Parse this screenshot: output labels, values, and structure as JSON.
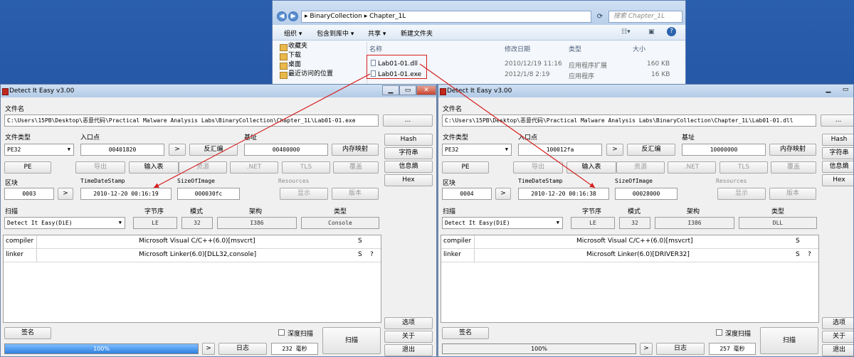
{
  "explorer": {
    "path": [
      "BinaryCollection",
      "Chapter_1L"
    ],
    "search_placeholder": "搜索 Chapter_1L",
    "toolbar": [
      "组织 ▾",
      "包含到库中 ▾",
      "共享 ▾",
      "新建文件夹"
    ],
    "sidebar": [
      "收藏夹",
      "下载",
      "桌面",
      "最近访问的位置"
    ],
    "columns": [
      "名称",
      "修改日期",
      "类型",
      "大小"
    ],
    "files": [
      {
        "name": "Lab01-01.dll",
        "date": "2010/12/19 11:16",
        "type": "应用程序扩展",
        "size": "160 KB"
      },
      {
        "name": "Lab01-01.exe",
        "date": "2012/1/8 2:19",
        "type": "应用程序",
        "size": "16 KB"
      }
    ]
  },
  "left": {
    "title": "Detect It Easy v3.00",
    "filename_label": "文件名",
    "filename": "C:\\Users\\15PB\\Desktop\\恶意代码\\Practical Malware Analysis Labs\\BinaryCollection\\Chapter_1L\\Lab01-01.exe",
    "filetype_label": "文件类型",
    "filetype": "PE32",
    "entry_label": "入口点",
    "entry": "00401820",
    "disasm": "反汇编",
    "base_label": "基址",
    "base": "00400000",
    "memmap": "内存映射",
    "pe": "PE",
    "export": "导出",
    "import": "输入表",
    "resource": "资源",
    "net": ".NET",
    "tls": "TLS",
    "overlay": "覆盖",
    "section_label": "区块",
    "section": "0003",
    "tds_label": "TimeDateStamp",
    "tds": "2010-12-20 00:16:19",
    "soi_label": "SizeOfImage",
    "soi": "000030fc",
    "res_label": "Resources",
    "show": "显示",
    "version": "版本",
    "scan_label": "扫描",
    "endian_label": "字节序",
    "mode_label": "模式",
    "arch_label": "架构",
    "type_label": "类型",
    "scanner": "Detect It Easy(DiE)",
    "endian": "LE",
    "mode": "32",
    "arch": "I386",
    "type": "Console",
    "rows": [
      {
        "k": "compiler",
        "v": "Microsoft Visual C/C++(6.0)[msvcrt]",
        "s": "S",
        "q": ""
      },
      {
        "k": "linker",
        "v": "Microsoft Linker(6.0)[DLL32,console]",
        "s": "S",
        "q": "?"
      }
    ],
    "hash": "Hash",
    "strings": "字符串",
    "entropy": "信息熵",
    "hex": "Hex",
    "options": "选项",
    "about": "关于",
    "exit": "退出",
    "sign": "签名",
    "deep": "深度扫描",
    "scan": "扫描",
    "progress_label": "100%",
    "progress": 1.0,
    "log": "日志",
    "time": "232 毫秒",
    "more": "...",
    "go": ">"
  },
  "right": {
    "title": "Detect It Easy v3.00",
    "filename_label": "文件名",
    "filename": "C:\\Users\\15PB\\Desktop\\恶意代码\\Practical Malware Analysis Labs\\BinaryCollection\\Chapter_1L\\Lab01-01.dll",
    "filetype_label": "文件类型",
    "filetype": "PE32",
    "entry_label": "入口点",
    "entry": "100012fa",
    "disasm": "反汇编",
    "base_label": "基址",
    "base": "10000000",
    "memmap": "内存映射",
    "pe": "PE",
    "export": "导出",
    "import": "输入表",
    "resource": "资源",
    "net": ".NET",
    "tls": "TLS",
    "overlay": "覆盖",
    "section_label": "区块",
    "section": "0004",
    "tds_label": "TimeDateStamp",
    "tds": "2010-12-20 00:16:38",
    "soi_label": "SizeOfImage",
    "soi": "00028000",
    "res_label": "Resources",
    "show": "显示",
    "version": "版本",
    "scan_label": "扫描",
    "endian_label": "字节序",
    "mode_label": "模式",
    "arch_label": "架构",
    "type_label": "类型",
    "scanner": "Detect It Easy(DiE)",
    "endian": "LE",
    "mode": "32",
    "arch": "I386",
    "type": "DLL",
    "rows": [
      {
        "k": "compiler",
        "v": "Microsoft Visual C/C++(6.0)[msvcrt]",
        "s": "S",
        "q": ""
      },
      {
        "k": "linker",
        "v": "Microsoft Linker(6.0)[DRIVER32]",
        "s": "S",
        "q": "?"
      }
    ],
    "hash": "Hash",
    "strings": "字符串",
    "entropy": "信息熵",
    "hex": "Hex",
    "options": "选项",
    "about": "关于",
    "exit": "退出",
    "sign": "签名",
    "deep": "深度扫描",
    "scan": "扫描",
    "progress_label": "100%",
    "progress": 1.0,
    "log": "日志",
    "time": "257 毫秒",
    "more": "...",
    "go": ">"
  },
  "colors": {
    "annotation": "#d62020",
    "progress": "#2e7fe0"
  }
}
